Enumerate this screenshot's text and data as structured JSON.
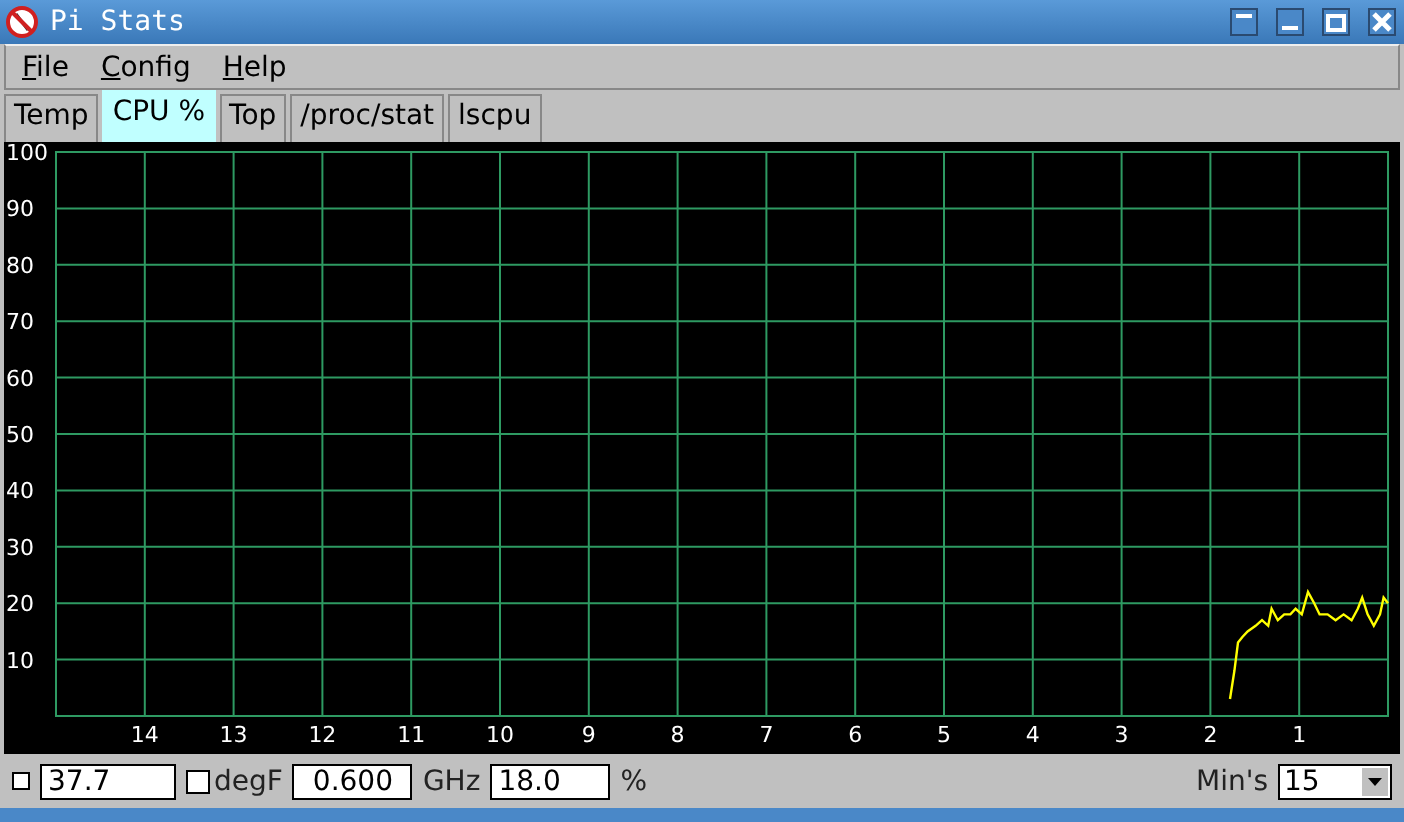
{
  "window": {
    "title": "Pi Stats"
  },
  "menu": [
    {
      "label": "File"
    },
    {
      "label": "Config"
    },
    {
      "label": "Help"
    }
  ],
  "tabs": [
    {
      "label": "Temp",
      "selected": false
    },
    {
      "label": "CPU %",
      "selected": true
    },
    {
      "label": "Top",
      "selected": false
    },
    {
      "label": "/proc/stat",
      "selected": false
    },
    {
      "label": "lscpu",
      "selected": false
    }
  ],
  "chart": {
    "chart_data": {
      "type": "line",
      "x": [
        1.78,
        1.73,
        1.69,
        1.64,
        1.58,
        1.49,
        1.42,
        1.35,
        1.31,
        1.24,
        1.17,
        1.1,
        1.04,
        0.97,
        0.9,
        0.83,
        0.77,
        0.68,
        0.59,
        0.5,
        0.41,
        0.34,
        0.29,
        0.23,
        0.16,
        0.09,
        0.05,
        0.0
      ],
      "grid": true,
      "series": [
        {
          "color": "#ffff00",
          "values": [
            3,
            8,
            13,
            14,
            15,
            16,
            17,
            16,
            19,
            17,
            18,
            18,
            19,
            18,
            22,
            20,
            18,
            18,
            17,
            18,
            17,
            19,
            21,
            18,
            16,
            18,
            21,
            20
          ]
        }
      ],
      "xlim": [
        15,
        0
      ],
      "ylim": [
        0,
        100
      ],
      "xticks": [
        14,
        13,
        12,
        11,
        10,
        9,
        8,
        7,
        6,
        5,
        4,
        3,
        2,
        1
      ],
      "yticks": [
        10,
        20,
        30,
        40,
        50,
        60,
        70,
        80,
        90,
        100
      ]
    }
  },
  "status_bar": {
    "left": [
      {
        "kind": "checkbox",
        "checked": false
      },
      {
        "kind": "field",
        "value": "37.7"
      },
      {
        "kind": "checkbox",
        "checked": false,
        "label": "degF"
      },
      {
        "kind": "field",
        "value": "0.600"
      },
      {
        "kind": "label",
        "text": "GHz"
      },
      {
        "kind": "field",
        "value": "18.0"
      },
      {
        "kind": "label",
        "text": "%"
      }
    ],
    "right": [
      {
        "kind": "label",
        "text": "Min's"
      },
      {
        "kind": "select",
        "value": "15"
      }
    ]
  }
}
